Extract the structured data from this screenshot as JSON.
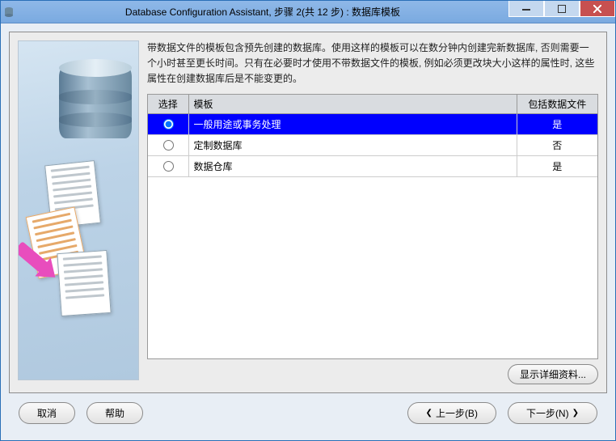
{
  "window": {
    "title": "Database Configuration Assistant, 步骤 2(共 12 步) : 数据库模板"
  },
  "description": "带数据文件的模板包含预先创建的数据库。使用这样的模板可以在数分钟内创建完新数据库, 否则需要一个小时甚至更长时间。只有在必要时才使用不带数据文件的模板, 例如必须更改块大小这样的属性时, 这些属性在创建数据库后是不能变更的。",
  "table": {
    "headers": {
      "select": "选择",
      "template": "模板",
      "includes_files": "包括数据文件"
    },
    "rows": [
      {
        "selected": true,
        "template": "一般用途或事务处理",
        "includes_files": "是"
      },
      {
        "selected": false,
        "template": "定制数据库",
        "includes_files": "否"
      },
      {
        "selected": false,
        "template": "数据仓库",
        "includes_files": "是"
      }
    ]
  },
  "buttons": {
    "show_details": "显示详细资料...",
    "cancel": "取消",
    "help": "帮助",
    "back": "上一步(B)",
    "next": "下一步(N)"
  }
}
